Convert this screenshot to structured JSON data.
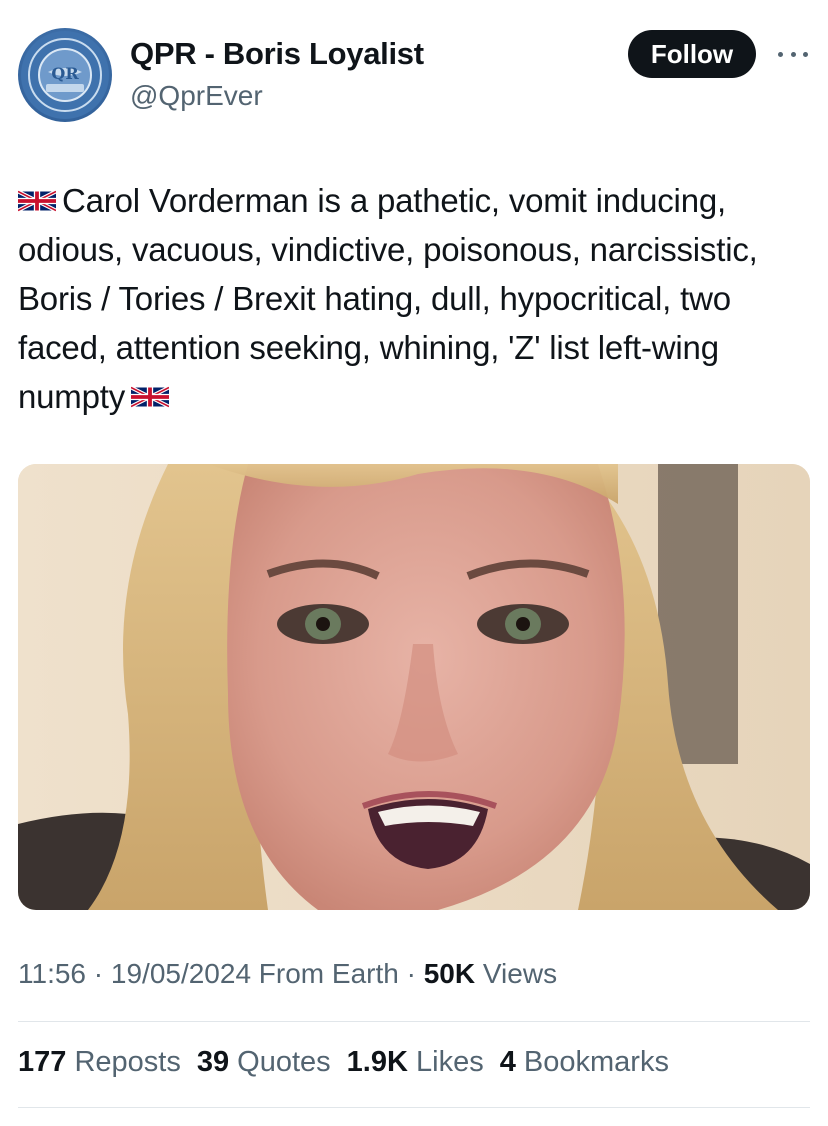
{
  "author": {
    "display_name": "QPR - Boris Loyalist",
    "handle": "@QprEver",
    "avatar_icon": "qpr-club-crest-icon"
  },
  "actions": {
    "follow_label": "Follow",
    "more_icon": "more-dots-icon"
  },
  "tweet": {
    "lead_flag": "uk-flag-emoji",
    "text": "Carol Vorderman is a pathetic, vomit inducing, odious, vacuous, vindictive, poisonous, narcissistic, Boris / Tories / Brexit hating, dull, hypocritical, two faced, attention seeking, whining, 'Z' list left-wing numpty",
    "trail_flag": "uk-flag-emoji"
  },
  "media": {
    "type": "photo",
    "subject": "close-up of blonde woman speaking"
  },
  "meta": {
    "time": "11:56",
    "sep1": " · ",
    "date": "19/05/2024",
    "source": " From Earth",
    "sep2": " · ",
    "views_count": "50K",
    "views_label": " Views"
  },
  "stats": {
    "reposts_count": "177",
    "reposts_label": "Reposts",
    "quotes_count": "39",
    "quotes_label": "Quotes",
    "likes_count": "1.9K",
    "likes_label": "Likes",
    "bookmarks_count": "4",
    "bookmarks_label": "Bookmarks"
  },
  "colors": {
    "text_primary": "#0f1419",
    "text_secondary": "#536471",
    "button_bg": "#0f1419",
    "divider": "#e1e6ea"
  }
}
